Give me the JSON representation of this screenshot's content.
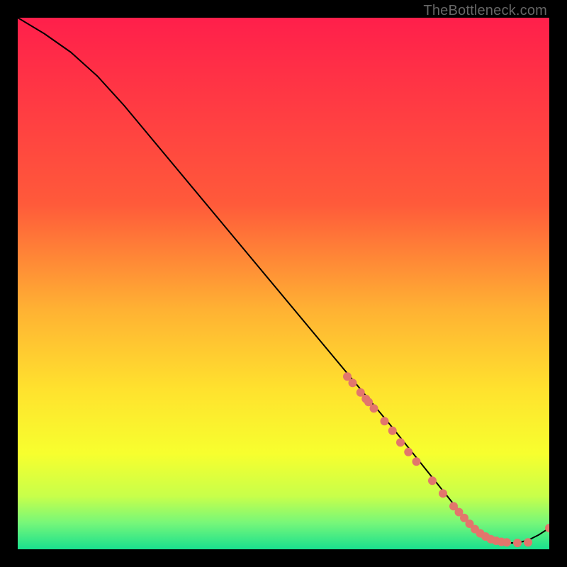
{
  "watermark": "TheBottleneck.com",
  "chart_data": {
    "type": "line",
    "title": "",
    "xlabel": "",
    "ylabel": "",
    "xlim": [
      0,
      100
    ],
    "ylim": [
      0,
      100
    ],
    "grid": false,
    "legend": false,
    "gradient_stops": [
      {
        "offset": 0,
        "color": "#ff1f4b"
      },
      {
        "offset": 0.35,
        "color": "#ff5a3a"
      },
      {
        "offset": 0.55,
        "color": "#ffb233"
      },
      {
        "offset": 0.7,
        "color": "#ffe22e"
      },
      {
        "offset": 0.82,
        "color": "#f7ff2e"
      },
      {
        "offset": 0.9,
        "color": "#c8ff4a"
      },
      {
        "offset": 0.95,
        "color": "#77f779"
      },
      {
        "offset": 1.0,
        "color": "#19e08e"
      }
    ],
    "series": [
      {
        "name": "curve",
        "x": [
          0,
          5,
          10,
          15,
          20,
          25,
          30,
          35,
          40,
          45,
          50,
          55,
          60,
          65,
          70,
          72,
          74,
          76,
          78,
          80,
          82,
          84,
          86,
          88,
          90,
          92,
          94,
          96,
          98,
          100
        ],
        "y": [
          100,
          97,
          93.5,
          89,
          83.5,
          77.5,
          71.5,
          65.5,
          59.5,
          53.5,
          47.5,
          41.5,
          35.5,
          29.5,
          23.5,
          21,
          18.5,
          16,
          13.5,
          11,
          8.5,
          6,
          4,
          2.5,
          1.5,
          1.2,
          1.2,
          1.7,
          2.7,
          4.0
        ]
      }
    ],
    "scatter": {
      "name": "points",
      "color": "#e2766c",
      "radius_px": 6,
      "x": [
        62,
        63,
        64.5,
        65.5,
        66,
        67,
        69,
        70.5,
        72,
        73.5,
        75,
        78,
        80,
        82,
        83,
        84,
        85,
        86,
        87,
        88,
        89,
        90,
        91,
        92,
        94,
        96,
        100
      ],
      "y": [
        32.5,
        31.3,
        29.5,
        28.3,
        27.7,
        26.5,
        24.1,
        22.3,
        20.1,
        18.3,
        16.5,
        12.9,
        10.5,
        8.1,
        7.0,
        5.9,
        4.8,
        3.8,
        3.0,
        2.4,
        1.9,
        1.6,
        1.4,
        1.3,
        1.2,
        1.3,
        4.0
      ]
    }
  }
}
